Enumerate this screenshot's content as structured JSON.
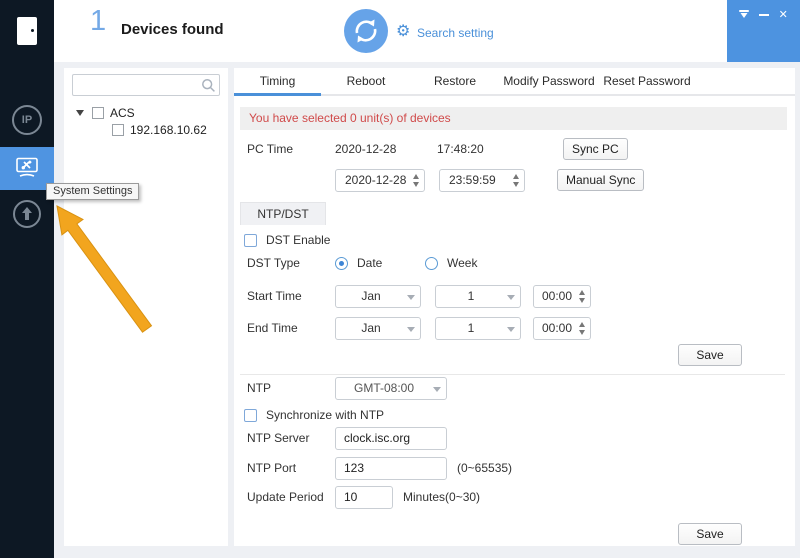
{
  "header": {
    "device_count": "1",
    "devices_found_label": "Devices found",
    "search_setting_label": "Search setting"
  },
  "window_controls": {
    "close_glyph": "✕"
  },
  "icons": {
    "gear_glyph": "⚙"
  },
  "sidebar": {
    "tooltip": "System Settings",
    "items": [
      "ip-settings",
      "system-settings",
      "upgrade"
    ],
    "active_item": "system-settings",
    "ip_icon_text": "IP"
  },
  "tree": {
    "search_value": "",
    "group_label": "ACS",
    "group_checked": false,
    "device_ip": "192.168.10.62",
    "device_checked": false
  },
  "tabs": [
    {
      "label": "Timing",
      "active": true
    },
    {
      "label": "Reboot",
      "active": false
    },
    {
      "label": "Restore",
      "active": false
    },
    {
      "label": "Modify Password",
      "active": false
    },
    {
      "label": "Reset Password",
      "active": false
    }
  ],
  "timing": {
    "selection_banner": "You have selected 0 unit(s) of devices",
    "pc_time": {
      "label": "PC Time",
      "date": "2020-12-28",
      "time": "17:48:20",
      "sync_button": "Sync PC"
    },
    "manual": {
      "date": "2020-12-28",
      "time": "23:59:59",
      "button": "Manual Sync"
    },
    "ntp_dst_tab_label": "NTP/DST",
    "dst": {
      "enable_label": "DST Enable",
      "enabled": false,
      "type_label": "DST Type",
      "options": [
        "Date",
        "Week"
      ],
      "selected": "Date"
    },
    "start_time": {
      "label": "Start Time",
      "month": "Jan",
      "day": "1",
      "time": "00:00"
    },
    "end_time": {
      "label": "End Time",
      "month": "Jan",
      "day": "1",
      "time": "00:00"
    },
    "dst_save_label": "Save",
    "ntp": {
      "label": "NTP",
      "timezone": "GMT-08:00",
      "sync_label": "Synchronize with NTP",
      "synchronized": false,
      "server_label": "NTP Server",
      "server": "clock.isc.org",
      "port_label": "NTP Port",
      "port": "123",
      "port_hint": "(0~65535)",
      "period_label": "Update Period",
      "period": "10",
      "period_hint": "Minutes(0~30)"
    },
    "ntp_save_label": "Save"
  },
  "colors": {
    "accent_blue": "#4a90d9",
    "sidebar_dark": "#0d1824",
    "active_item_blue": "#4f94e1",
    "titlebar_blue": "#4d93e0",
    "banner_red_text": "#d04a4a",
    "banner_bg": "#efefef",
    "annotation_arrow_orange": "#f2a51e"
  }
}
